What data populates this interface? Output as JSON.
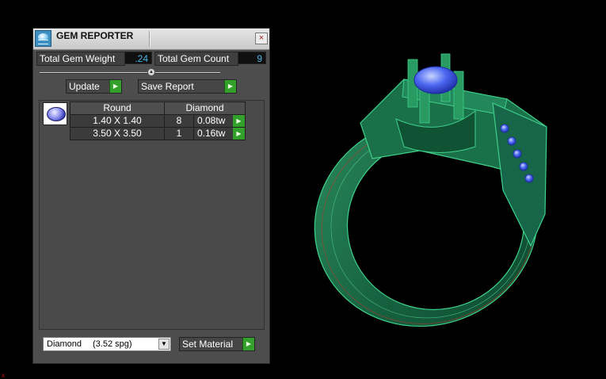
{
  "window": {
    "title": "GEM REPORTER",
    "close_symbol": "×"
  },
  "totals": {
    "weight_label": "Total Gem Weight",
    "weight_value": ".24",
    "count_label": "Total Gem Count",
    "count_value": "9"
  },
  "actions": {
    "update_label": "Update",
    "save_report_label": "Save Report",
    "play_symbol": "▶"
  },
  "gem_table": {
    "headers": [
      "Round",
      "Diamond"
    ],
    "rows": [
      {
        "size": "1.40 X 1.40",
        "count": "8",
        "weight": "0.08tw"
      },
      {
        "size": "3.50 X 3.50",
        "count": "1",
        "weight": "0.16tw"
      }
    ]
  },
  "material": {
    "selected_name": "Diamond",
    "selected_spg": "(3.52 spg)",
    "dropdown_symbol": "▼",
    "set_label": "Set Material"
  },
  "status": {
    "error_mark": "x"
  },
  "colors": {
    "accent_green": "#33a02c",
    "value_cyan": "#49b6e8",
    "ring_green": "#1b6b45",
    "ring_edge": "#3fd08a",
    "stone_blue": "#3b56e8"
  }
}
